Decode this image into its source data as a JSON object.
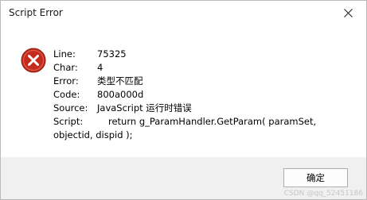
{
  "window": {
    "title": "Script Error"
  },
  "colors": {
    "icon_red": "#c42b1c",
    "footer_bg": "#f0f0f0"
  },
  "icons": {
    "error": "error-icon",
    "close": "close-icon"
  },
  "details": {
    "line": {
      "label": "Line:",
      "value": "75325"
    },
    "char": {
      "label": "Char:",
      "value": "4"
    },
    "error": {
      "label": "Error:",
      "value": "类型不匹配"
    },
    "code": {
      "label": "Code:",
      "value": "800a000d"
    },
    "source": {
      "label": "Source:",
      "value": "JavaScript 运行时错误"
    },
    "script": {
      "label": "Script:",
      "value": "return g_ParamHandler.GetParam( paramSet, objectid, dispid );"
    }
  },
  "footer": {
    "ok_label": "确定"
  },
  "watermark": "CSDN @qq_52451186"
}
